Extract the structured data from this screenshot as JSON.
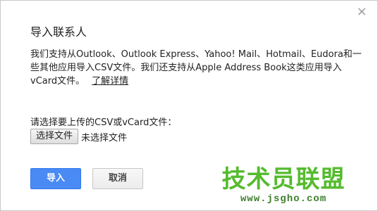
{
  "dialog": {
    "title": "导入联系人",
    "close_icon": "×",
    "description": "我们支持从Outlook、Outlook Express、Yahoo! Mail、Hotmail、Eudora和一些其他应用导入CSV文件。我们还支持从Apple Address Book这类应用导入vCard文件。",
    "learn_more": "了解详情",
    "file_prompt": "请选择要上传的CSV或vCard文件：",
    "choose_file_label": "选择文件",
    "file_status": "未选择文件",
    "import_label": "导入",
    "cancel_label": "取消"
  },
  "watermark": {
    "title": "技术员联盟",
    "url": "www.jsgho.com"
  },
  "colors": {
    "primary_button": "#4a8af4",
    "watermark_green": "#55bb2e"
  }
}
